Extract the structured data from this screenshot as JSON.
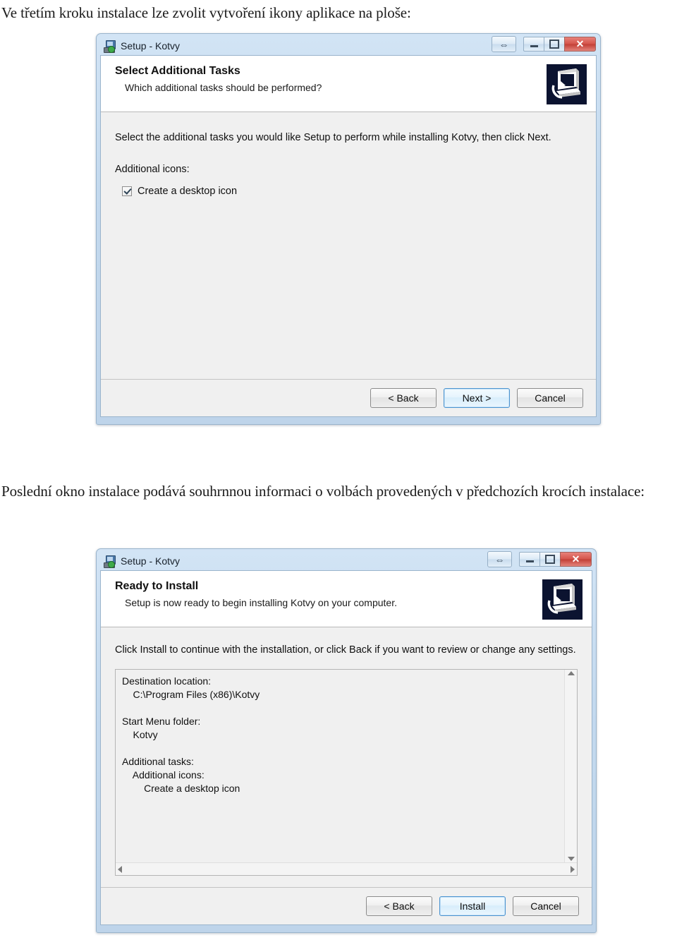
{
  "document": {
    "intro_paragraph": "Ve třetím kroku instalace lze zvolit vytvoření ikony aplikace na ploše:",
    "summary_paragraph": "Poslední okno instalace podává souhrnnou informaci o volbách provedených v předchozích krocích instalace:"
  },
  "window_controls": {
    "help_glyph": "⇔",
    "minimize_label": "Minimize",
    "maximize_label": "Maximize",
    "close_glyph": "✕"
  },
  "dialog_select_tasks": {
    "title": "Setup - Kotvy",
    "app_icon": "setup-app-icon",
    "banner_icon": "computer-install-icon",
    "heading": "Select Additional Tasks",
    "subheading": "Which additional tasks should be performed?",
    "instruction": "Select the additional tasks you would like Setup to perform while installing Kotvy, then click Next.",
    "group_label": "Additional icons:",
    "checkbox": {
      "label": "Create a desktop icon",
      "checked": true
    },
    "buttons": {
      "back": "< Back",
      "next": "Next >",
      "cancel": "Cancel"
    }
  },
  "dialog_ready_install": {
    "title": "Setup - Kotvy",
    "app_icon": "setup-app-icon",
    "banner_icon": "computer-install-icon",
    "heading": "Ready to Install",
    "subheading": "Setup is now ready to begin installing Kotvy on your computer.",
    "instruction": "Click Install to continue with the installation, or click Back if you want to review or change any settings.",
    "summary_text": "Destination location:\n    C:\\Program Files (x86)\\Kotvy\n\nStart Menu folder:\n    Kotvy\n\nAdditional tasks:\n    Additional icons:\n        Create a desktop icon",
    "buttons": {
      "back": "< Back",
      "install": "Install",
      "cancel": "Cancel"
    }
  }
}
